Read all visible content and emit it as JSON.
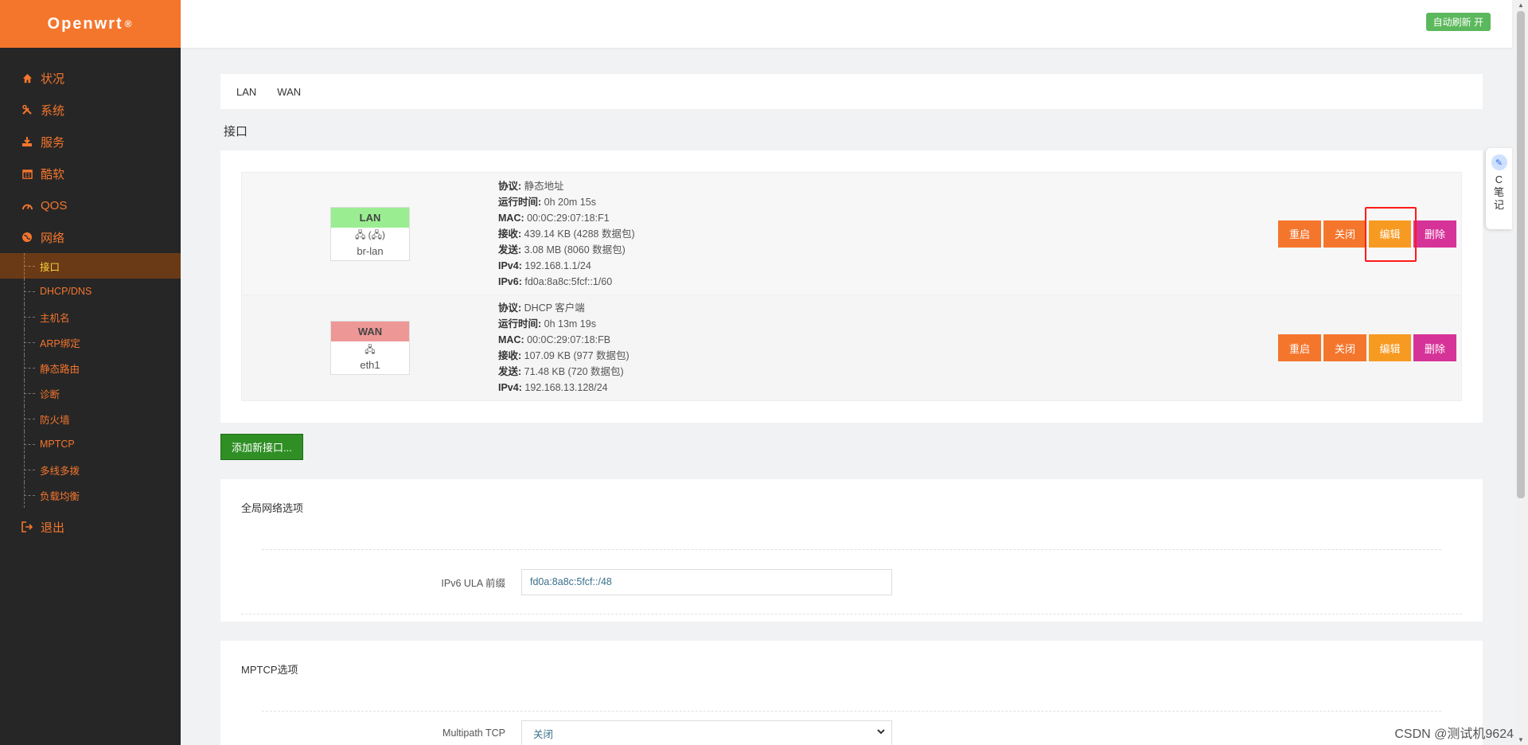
{
  "brand": {
    "name": "Openwrt",
    "mark": "®"
  },
  "sidebar": {
    "items_top": [
      {
        "label": "状况",
        "icon": "home-icon"
      },
      {
        "label": "系统",
        "icon": "tools-icon"
      },
      {
        "label": "服务",
        "icon": "download-icon"
      },
      {
        "label": "酷软",
        "icon": "calendar-icon"
      },
      {
        "label": "QOS",
        "icon": "gauge-icon"
      },
      {
        "label": "网络",
        "icon": "globe-icon"
      }
    ],
    "sub_items": [
      "接口",
      "DHCP/DNS",
      "主机名",
      "ARP绑定",
      "静态路由",
      "诊断",
      "防火墙",
      "MPTCP",
      "多线多拨",
      "负载均衡"
    ],
    "logout": {
      "label": "退出",
      "icon": "logout-icon"
    }
  },
  "topbar": {
    "auto_refresh": "自动刷新 开"
  },
  "tabs": [
    "LAN",
    "WAN"
  ],
  "section_title": "接口",
  "interfaces": [
    {
      "name": "LAN",
      "icons": "🖧 (🖧)",
      "device": "br-lan",
      "info": [
        {
          "k": "协议:",
          "v": " 静态地址"
        },
        {
          "k": "运行时间:",
          "v": " 0h 20m 15s"
        },
        {
          "k": "MAC:",
          "v": " 00:0C:29:07:18:F1"
        },
        {
          "k": "接收:",
          "v": " 439.14 KB (4288 数据包)"
        },
        {
          "k": "发送:",
          "v": " 3.08 MB (8060 数据包)"
        },
        {
          "k": "IPv4:",
          "v": " 192.168.1.1/24"
        },
        {
          "k": "IPv6:",
          "v": " fd0a:8a8c:5fcf::1/60"
        }
      ]
    },
    {
      "name": "WAN",
      "icons": "🖧",
      "device": "eth1",
      "info": [
        {
          "k": "协议:",
          "v": " DHCP 客户端"
        },
        {
          "k": "运行时间:",
          "v": " 0h 13m 19s"
        },
        {
          "k": "MAC:",
          "v": " 00:0C:29:07:18:FB"
        },
        {
          "k": "接收:",
          "v": " 107.09 KB (977 数据包)"
        },
        {
          "k": "发送:",
          "v": " 71.48 KB (720 数据包)"
        },
        {
          "k": "IPv4:",
          "v": " 192.168.13.128/24"
        }
      ]
    }
  ],
  "actions": {
    "restart": "重启",
    "stop": "关闭",
    "edit": "编辑",
    "delete": "删除"
  },
  "add_interface": "添加新接口...",
  "global_options": {
    "title": "全局网络选项",
    "ula_label": "IPv6 ULA 前缀",
    "ula_value": "fd0a:8a8c:5fcf::/48"
  },
  "mptcp_options": {
    "title": "MPTCP选项",
    "mptcp_label": "Multipath TCP",
    "mptcp_value": "关闭"
  },
  "note_widget": {
    "line1": "C",
    "line2": "笔",
    "line3": "记"
  },
  "watermark": "CSDN @测试机9624"
}
